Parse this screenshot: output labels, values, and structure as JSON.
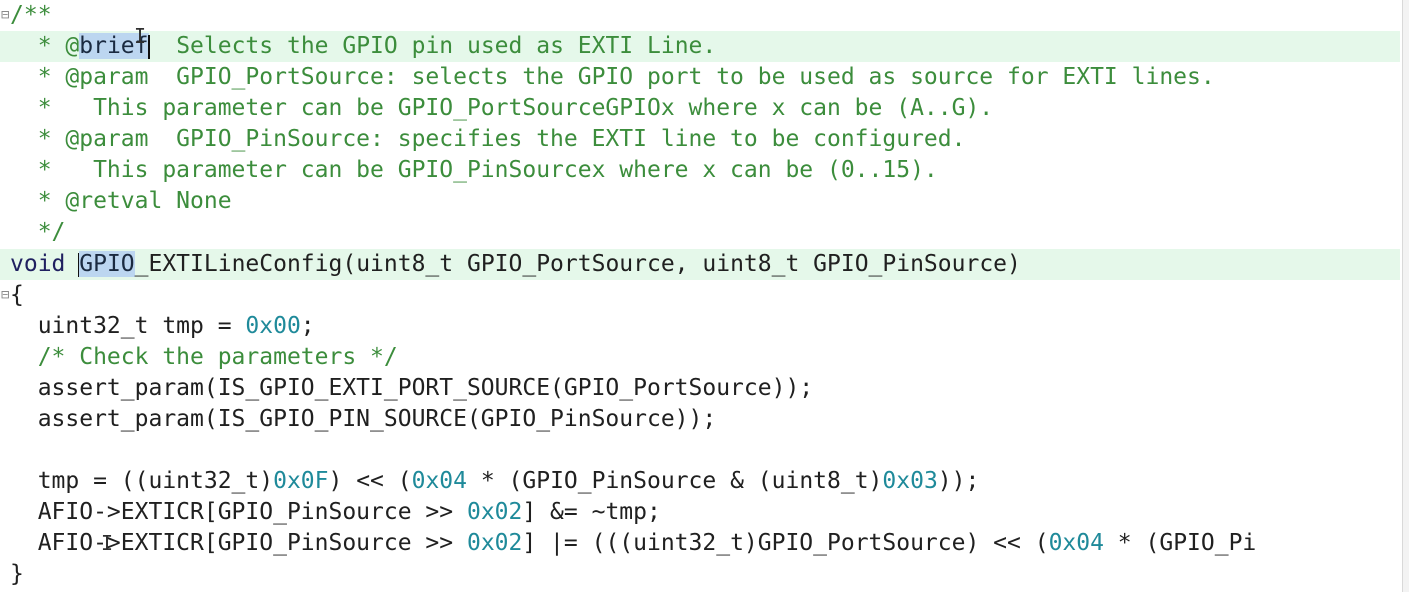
{
  "editor": {
    "lines": [
      {
        "gutter": "⊟",
        "code": "/**"
      },
      {
        "gutter": "",
        "code": "  * @brief  Selects the GPIO pin used as EXTI Line."
      },
      {
        "gutter": "",
        "code": "  * @param  GPIO_PortSource: selects the GPIO port to be used as source for EXTI lines."
      },
      {
        "gutter": "",
        "code": "  *   This parameter can be GPIO_PortSourceGPIOx where x can be (A..G)."
      },
      {
        "gutter": "",
        "code": "  * @param  GPIO_PinSource: specifies the EXTI line to be configured."
      },
      {
        "gutter": "",
        "code": "  *   This parameter can be GPIO_PinSourcex where x can be (0..15)."
      },
      {
        "gutter": "",
        "code": "  * @retval None"
      },
      {
        "gutter": "",
        "code": "  */"
      },
      {
        "gutter": "",
        "code": "void GPIO_EXTILineConfig(uint8_t GPIO_PortSource, uint8_t GPIO_PinSource)"
      },
      {
        "gutter": "⊟",
        "code": "{"
      },
      {
        "gutter": "",
        "code": "  uint32_t tmp = 0x00;"
      },
      {
        "gutter": "",
        "code": "  /* Check the parameters */"
      },
      {
        "gutter": "",
        "code": "  assert_param(IS_GPIO_EXTI_PORT_SOURCE(GPIO_PortSource));"
      },
      {
        "gutter": "",
        "code": "  assert_param(IS_GPIO_PIN_SOURCE(GPIO_PinSource));"
      },
      {
        "gutter": "",
        "code": ""
      },
      {
        "gutter": "",
        "code": "  tmp = ((uint32_t)0x0F) << (0x04 * (GPIO_PinSource & (uint8_t)0x03));"
      },
      {
        "gutter": "",
        "code": "  AFIO->EXTICR[GPIO_PinSource >> 0x02] &= ~tmp;"
      },
      {
        "gutter": "",
        "code": "  AFIO->EXTICR[GPIO_PinSource >> 0x02] |= (((uint32_t)GPIO_PortSource) << (0x04 * (GPIO_Pi"
      },
      {
        "gutter": "",
        "code": "}"
      }
    ]
  },
  "colors": {
    "background": "#ffffff",
    "current_line_highlight": "#e5f8ea",
    "selection": "#bcd6f0",
    "comment": "#3c8d3c",
    "number": "#1f8a9a",
    "text": "#202020"
  }
}
